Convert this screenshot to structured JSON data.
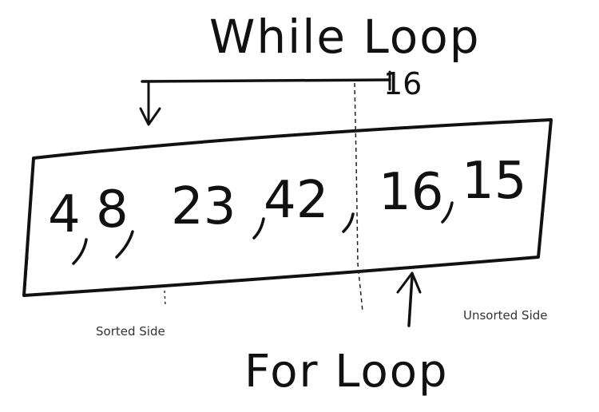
{
  "diagram": {
    "top_label": "While Loop",
    "pointer_value": "16",
    "numbers": [
      "4",
      "8",
      "23",
      "42",
      "16",
      "15"
    ],
    "sorted_label": "Sorted Side",
    "unsorted_label": "Unsorted Side",
    "bottom_label": "For Loop",
    "ink_color": "#111111"
  }
}
